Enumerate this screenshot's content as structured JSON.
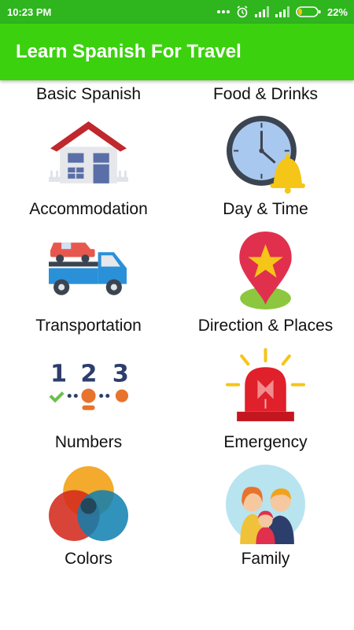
{
  "status_bar": {
    "time": "10:23 PM",
    "battery_percent": "22%",
    "battery_level": 0.22,
    "icons": [
      "dots-icon",
      "alarm-icon",
      "signal-icon",
      "signal-icon",
      "battery-icon"
    ]
  },
  "app_bar": {
    "title": "Learn Spanish For Travel"
  },
  "categories": [
    {
      "label": "Basic Spanish"
    },
    {
      "label": "Food & Drinks"
    },
    {
      "label": "Accommodation",
      "icon": "house-icon"
    },
    {
      "label": "Day & Time",
      "icon": "clock-bell-icon"
    },
    {
      "label": "Transportation",
      "icon": "tow-truck-icon"
    },
    {
      "label": "Direction & Places",
      "icon": "map-pin-star-icon"
    },
    {
      "label": "Numbers",
      "icon": "numbers-icon"
    },
    {
      "label": "Emergency",
      "icon": "siren-icon"
    },
    {
      "label": "Colors",
      "icon": "color-circles-icon"
    },
    {
      "label": "Family",
      "icon": "family-icon"
    }
  ],
  "colors": {
    "status_bar": "#2fb51e",
    "app_bar": "#3cd10f"
  }
}
